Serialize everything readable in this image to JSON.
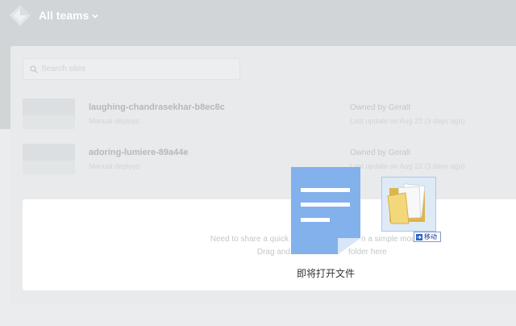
{
  "header": {
    "team_title": "All teams",
    "logo_icon": "netlify-logo-icon",
    "chevron_icon": "chevron-down-icon"
  },
  "search": {
    "placeholder": "Search sites",
    "icon": "search-icon"
  },
  "sites": [
    {
      "name": "laughing-chandrasekhar-b8ec8c",
      "deploy_type": "Manual deploys",
      "owner": "Owned by Geralt",
      "updated": "Last update on Aug 22 (3 days ago)"
    },
    {
      "name": "adoring-lumiere-89a44e",
      "deploy_type": "Manual deploys",
      "owner": "Owned by Geralt",
      "updated": "Last update on Aug 22 (3 days ago)"
    }
  ],
  "dropzone": {
    "line1_visible_start": "Need to share a quick",
    "line1_visible_end": "n a simple mod",
    "line2_visible_start": "Drag and",
    "line2_visible_end": "folder here"
  },
  "drag_ghost": {
    "file_icon": "document-icon",
    "caption": "即将打开文件",
    "target_icon": "folder-icon",
    "action_icon": "move-arrow-icon",
    "action_badge": "移动"
  },
  "colors": {
    "header-bg": "#d1d5d7",
    "panel-bg": "#e8eaeb",
    "page-bg": "#eaeced",
    "card-bg": "#ffffff",
    "doc-blue": "#82b1ec",
    "doc-fold": "#d8e6f8",
    "folder-yellow": "#f3d77b",
    "badge-blue": "#2b63c6"
  }
}
